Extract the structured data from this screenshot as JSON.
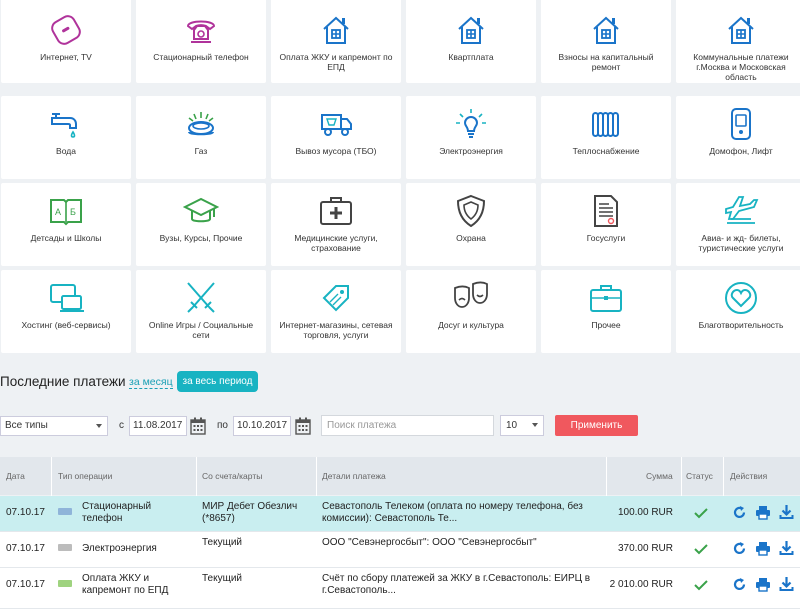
{
  "tiles": [
    {
      "label": "Интернет, TV",
      "icon": "router-icon"
    },
    {
      "label": "Стационарный телефон",
      "icon": "phone-icon"
    },
    {
      "label": "Оплата ЖКУ и капремонт по ЕПД",
      "icon": "house-icon"
    },
    {
      "label": "Квартплата",
      "icon": "house-icon"
    },
    {
      "label": "Взносы на капитальный ремонт",
      "icon": "house-icon"
    },
    {
      "label": "Коммунальные платежи г.Москва и Московская область",
      "icon": "house-icon"
    },
    {
      "label": "Вода",
      "icon": "faucet-icon"
    },
    {
      "label": "Газ",
      "icon": "gas-burner-icon"
    },
    {
      "label": "Вывоз мусора (ТБО)",
      "icon": "truck-icon"
    },
    {
      "label": "Электроэнергия",
      "icon": "lightbulb-icon"
    },
    {
      "label": "Теплоснабжение",
      "icon": "radiator-icon"
    },
    {
      "label": "Домофон, Лифт",
      "icon": "intercom-icon"
    },
    {
      "label": "Детсады и Школы",
      "icon": "book-icon"
    },
    {
      "label": "Вузы, Курсы, Прочие",
      "icon": "graduation-cap-icon"
    },
    {
      "label": "Медицинские услуги, страхование",
      "icon": "medkit-icon"
    },
    {
      "label": "Охрана",
      "icon": "shield-icon"
    },
    {
      "label": "Госуслуги",
      "icon": "document-icon"
    },
    {
      "label": "Авиа- и жд- билеты, туристические услуги",
      "icon": "airplane-icon"
    },
    {
      "label": "Хостинг (веб-сервисы)",
      "icon": "hosting-icon"
    },
    {
      "label": "Online Игры / Социальные сети",
      "icon": "swords-icon"
    },
    {
      "label": "Интернет-магазины, сетевая торговля, услуги",
      "icon": "price-tag-icon"
    },
    {
      "label": "Досуг и культура",
      "icon": "theatre-masks-icon"
    },
    {
      "label": "Прочее",
      "icon": "briefcase-icon"
    },
    {
      "label": "Благотворительность",
      "icon": "heart-icon"
    }
  ],
  "recent": {
    "title": "Последние платежи",
    "link_month": "за месяц",
    "btn_all": "за весь период"
  },
  "filters": {
    "type": "Все типы",
    "from_label": "с",
    "from": "11.08.2017",
    "to_label": "по",
    "to": "10.10.2017",
    "search_placeholder": "Поиск платежа",
    "count": "10",
    "apply": "Применить"
  },
  "table": {
    "headers": {
      "date": "Дата",
      "type": "Тип операции",
      "account": "Со счета/карты",
      "details": "Детали платежа",
      "sum": "Сумма",
      "status": "Статус",
      "actions": "Действия"
    },
    "rows": [
      {
        "date": "07.10.17",
        "type": "Стационарный телефон",
        "account": "МИР Дебет Обезлич (*8657)",
        "details": "Севастополь Телеком (оплата по номеру телефона, без комиссии): Севастополь Те...",
        "sum": "100.00 RUR"
      },
      {
        "date": "07.10.17",
        "type": "Электроэнергия",
        "account": "Текущий",
        "details": "ООО \"Севэнергосбыт\": ООО \"Севэнергосбыт\"",
        "sum": "370.00 RUR"
      },
      {
        "date": "07.10.17",
        "type": "Оплата ЖКУ и капремонт по ЕПД",
        "account": "Текущий",
        "details": "Счёт по сбору платежей за ЖКУ в г.Севастополь: ЕИРЦ в г.Севастополь...",
        "sum": "2 010.00 RUR"
      }
    ]
  },
  "colors": {
    "teal": "#18b3c2",
    "blue": "#1a74c9",
    "magenta": "#b0339b",
    "green": "#3aa24a",
    "red": "#f0585e"
  }
}
